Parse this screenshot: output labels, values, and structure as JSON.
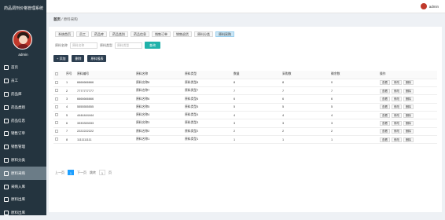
{
  "app": {
    "title": "药品调剂价格管理系统"
  },
  "user": {
    "name": "admin",
    "top_name": "admin"
  },
  "menu": [
    {
      "label": "首页",
      "icon": "home-icon"
    },
    {
      "label": "员工",
      "icon": "user-icon"
    },
    {
      "label": "药品库",
      "icon": "db-icon"
    },
    {
      "label": "药品类别",
      "icon": "tag-icon"
    },
    {
      "label": "药品信息",
      "icon": "pill-icon"
    },
    {
      "label": "销售订单",
      "icon": "order-icon"
    },
    {
      "label": "销售管理",
      "icon": "sales-icon"
    },
    {
      "label": "原料分类",
      "icon": "category-icon"
    },
    {
      "label": "原料采购",
      "icon": "purchase-icon"
    },
    {
      "label": "采购入库",
      "icon": "inbound-icon"
    },
    {
      "label": "原料出库",
      "icon": "outbound-icon"
    },
    {
      "label": "原料出库",
      "icon": "outbound-icon"
    }
  ],
  "breadcrumb": {
    "home": "首页",
    "sep": "/",
    "current": "原料采购"
  },
  "tabs": [
    "系统首页",
    "员工",
    "药品库",
    "药品类别",
    "药品信息",
    "销售订单",
    "销售退货",
    "原料分类",
    "原料采购"
  ],
  "search": {
    "label1": "原料名称",
    "placeholder1": "原料名称",
    "label2": "原料类型",
    "placeholder2": "原料类型",
    "button": "查询"
  },
  "actions": {
    "add": "+ 添加",
    "delete": "删除",
    "export": "原料报表"
  },
  "table": {
    "headers": [
      "",
      "序号",
      "原料编号",
      "原料名称",
      "原料类型",
      "数量",
      "采购数",
      "剩余数",
      "操作"
    ],
    "rows": [
      {
        "idx": "1",
        "code": "6666666666",
        "name": "原料名称8",
        "type": "原料类型8",
        "qty": "8",
        "buy": "8",
        "rest": "0"
      },
      {
        "idx": "2",
        "code": "7777777777",
        "name": "原料名称7",
        "type": "原料类型7",
        "qty": "7",
        "buy": "7",
        "rest": "7"
      },
      {
        "idx": "3",
        "code": "6666666666",
        "name": "原料名称6",
        "type": "原料类型6",
        "qty": "6",
        "buy": "6",
        "rest": "6"
      },
      {
        "idx": "4",
        "code": "5555555555",
        "name": "原料名称5",
        "type": "原料类型5",
        "qty": "5",
        "buy": "5",
        "rest": "5"
      },
      {
        "idx": "5",
        "code": "4444444444",
        "name": "原料名称4",
        "type": "原料类型4",
        "qty": "4",
        "buy": "4",
        "rest": "4"
      },
      {
        "idx": "6",
        "code": "3333333333",
        "name": "原料名称3",
        "type": "原料类型3",
        "qty": "3",
        "buy": "3",
        "rest": "3"
      },
      {
        "idx": "7",
        "code": "2222222222",
        "name": "原料名称2",
        "type": "原料类型2",
        "qty": "2",
        "buy": "2",
        "rest": "2"
      },
      {
        "idx": "8",
        "code": "1111111111",
        "name": "原料名称1",
        "type": "原料类型1",
        "qty": "1",
        "buy": "1",
        "rest": "1"
      }
    ],
    "ops": [
      "查看",
      "修改",
      "删除"
    ]
  },
  "pager": {
    "prev": "上一页",
    "cur": "1",
    "next": "下一页",
    "goto": "跳转",
    "page": "1",
    "unit": "页"
  }
}
